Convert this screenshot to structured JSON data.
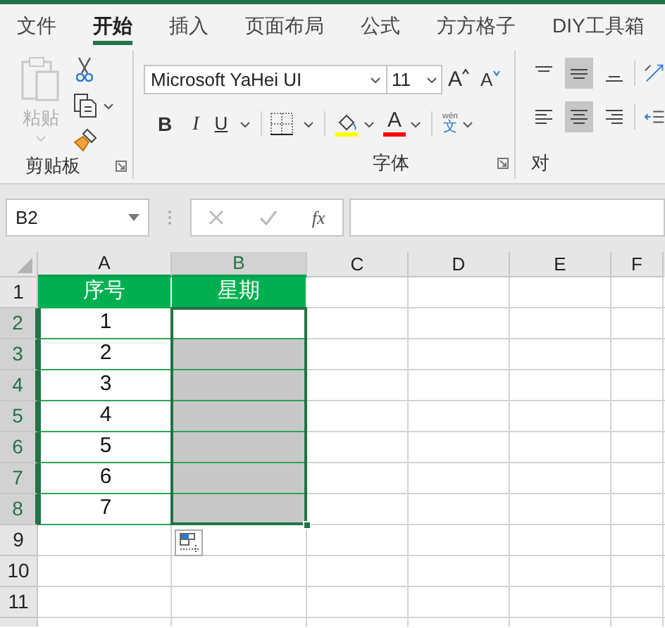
{
  "tabs": [
    {
      "label": "文件",
      "selected": false
    },
    {
      "label": "开始",
      "selected": true
    },
    {
      "label": "插入",
      "selected": false
    },
    {
      "label": "页面布局",
      "selected": false
    },
    {
      "label": "公式",
      "selected": false
    },
    {
      "label": "方方格子",
      "selected": false
    },
    {
      "label": "DIY工具箱",
      "selected": false
    }
  ],
  "ribbon": {
    "clipboard": {
      "paste_label": "粘贴",
      "paste_disabled": true,
      "title": "剪贴板"
    },
    "font": {
      "font_name": "Microsoft YaHei UI",
      "font_size": "11",
      "grow": "A",
      "shrink": "A",
      "bold": "B",
      "italic": "I",
      "underline": "U",
      "font_color": "A",
      "phonetic_ruby": "wén",
      "phonetic": "文",
      "title": "字体"
    },
    "alignment": {
      "title": "对",
      "top_row": [
        {
          "kind": "top",
          "selected": false
        },
        {
          "kind": "middle",
          "selected": true
        },
        {
          "kind": "bottom",
          "selected": false
        }
      ],
      "bottom_row": [
        {
          "kind": "left",
          "selected": false
        },
        {
          "kind": "center",
          "selected": true
        },
        {
          "kind": "right",
          "selected": false
        }
      ]
    }
  },
  "formula_bar": {
    "name_box": "B2",
    "fx": "fx"
  },
  "sheet": {
    "columns": [
      {
        "label": "A",
        "selected": false,
        "highlighted": true
      },
      {
        "label": "B",
        "selected": true,
        "highlighted": true
      },
      {
        "label": "C",
        "selected": false,
        "highlighted": false
      },
      {
        "label": "D",
        "selected": false,
        "highlighted": false
      },
      {
        "label": "E",
        "selected": false,
        "highlighted": false
      },
      {
        "label": "F",
        "selected": false,
        "highlighted": false
      }
    ],
    "rows": [
      {
        "label": "1",
        "selected": false,
        "cells": [
          {
            "kind": "header",
            "text": "序号",
            "selected": false
          },
          {
            "kind": "header",
            "text": "星期",
            "selected": false
          }
        ]
      },
      {
        "label": "2",
        "selected": true,
        "cells": [
          {
            "kind": "data",
            "text": "1",
            "selected": false
          },
          {
            "kind": "data",
            "selected": true
          }
        ]
      },
      {
        "label": "3",
        "selected": true,
        "cells": [
          {
            "kind": "data",
            "text": "2",
            "selected": false
          },
          {
            "kind": "data",
            "selected": true
          }
        ]
      },
      {
        "label": "4",
        "selected": true,
        "cells": [
          {
            "kind": "data",
            "text": "3",
            "selected": false
          },
          {
            "kind": "data",
            "selected": true
          }
        ]
      },
      {
        "label": "5",
        "selected": true,
        "cells": [
          {
            "kind": "data",
            "text": "4",
            "selected": false
          },
          {
            "kind": "data",
            "selected": true
          }
        ]
      },
      {
        "label": "6",
        "selected": true,
        "cells": [
          {
            "kind": "data",
            "text": "5",
            "selected": false
          },
          {
            "kind": "data",
            "selected": true
          }
        ]
      },
      {
        "label": "7",
        "selected": true,
        "cells": [
          {
            "kind": "data",
            "text": "6",
            "selected": false
          },
          {
            "kind": "data",
            "selected": true
          }
        ]
      },
      {
        "label": "8",
        "selected": true,
        "cells": [
          {
            "kind": "data",
            "text": "7",
            "selected": false
          },
          {
            "kind": "data",
            "selected": true
          }
        ]
      },
      {
        "label": "9",
        "selected": false
      },
      {
        "label": "10",
        "selected": false
      },
      {
        "label": "11",
        "selected": false
      }
    ]
  }
}
